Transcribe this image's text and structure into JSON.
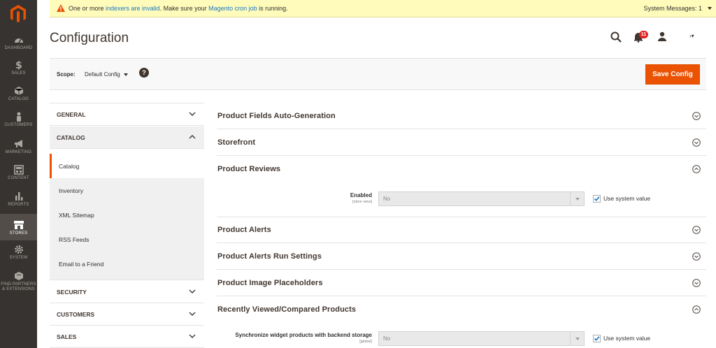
{
  "nav": {
    "items": [
      {
        "label": "DASHBOARD",
        "icon": "dashboard-icon"
      },
      {
        "label": "SALES",
        "icon": "dollar-icon"
      },
      {
        "label": "CATALOG",
        "icon": "cube-icon"
      },
      {
        "label": "CUSTOMERS",
        "icon": "person-icon"
      },
      {
        "label": "MARKETING",
        "icon": "megaphone-icon"
      },
      {
        "label": "CONTENT",
        "icon": "layout-icon"
      },
      {
        "label": "REPORTS",
        "icon": "bar-chart-icon"
      },
      {
        "label": "STORES",
        "icon": "store-icon"
      },
      {
        "label": "SYSTEM",
        "icon": "gear-icon"
      },
      {
        "label_line1": "FIND PARTNERS",
        "label_line2": "& EXTENSIONS",
        "icon": "box-icon"
      }
    ]
  },
  "system_message": {
    "prefix": "One or more ",
    "link1": "indexers are invalid",
    "middle": ". Make sure your ",
    "link2": "Magento cron job",
    "suffix": " is running.",
    "counter": "System Messages: 1"
  },
  "header": {
    "title": "Configuration",
    "notification_count": "11",
    "user_name": "·",
    "more": "›▾"
  },
  "scope": {
    "label": "Scope:",
    "value": "Default Config",
    "help": "?",
    "save_label": "Save Config"
  },
  "sidebar": {
    "sections": {
      "general": "GENERAL",
      "catalog": "CATALOG",
      "security": "SECURITY",
      "customers": "CUSTOMERS",
      "sales": "SALES"
    },
    "catalog_items": [
      "Catalog",
      "Inventory",
      "XML Sitemap",
      "RSS Feeds",
      "Email to a Friend"
    ]
  },
  "groups": [
    "Product Fields Auto-Generation",
    "Storefront",
    "Product Reviews",
    "Product Alerts",
    "Product Alerts Run Settings",
    "Product Image Placeholders",
    "Recently Viewed/Compared Products"
  ],
  "fields": {
    "reviews_enabled": {
      "label": "Enabled",
      "scope": "[store view]",
      "value": "No",
      "checkbox_label": "Use system value"
    },
    "sync_widget": {
      "label": "Synchronize widget products with backend storage",
      "scope": "[global]",
      "value": "No",
      "checkbox_label": "Use system value"
    }
  },
  "colors": {
    "accent": "#eb5202",
    "nav_bg": "#373330",
    "message_bg": "#fffbbb"
  }
}
